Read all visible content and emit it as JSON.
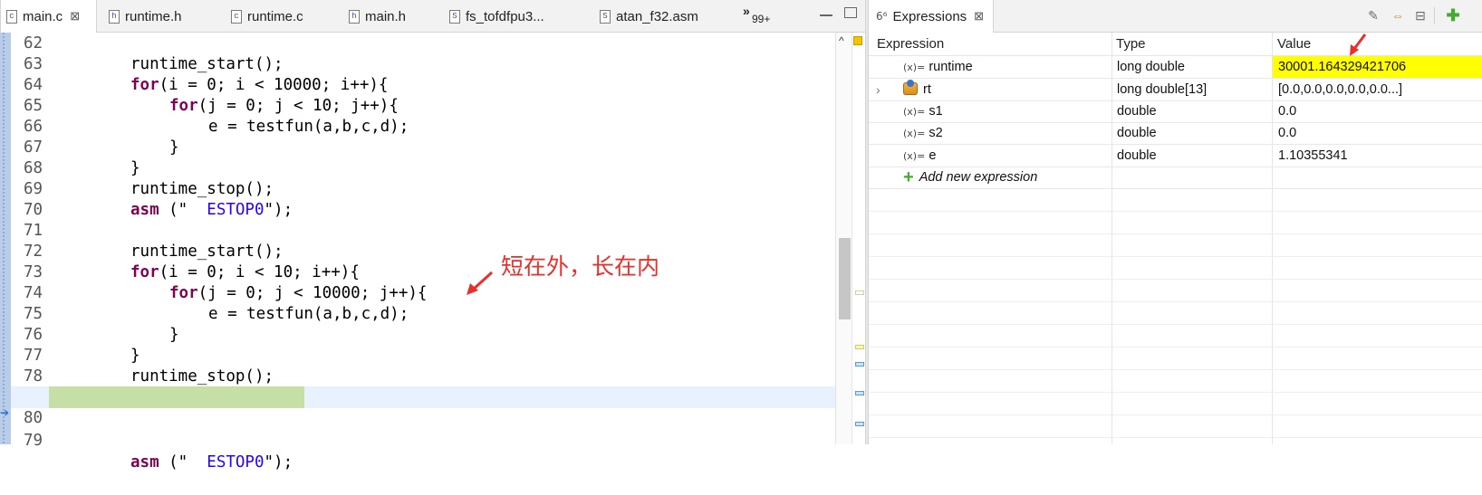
{
  "editor": {
    "tabs": [
      {
        "label": "main.c",
        "type": "c",
        "close": "⊠"
      },
      {
        "label": "runtime.h",
        "type": "h"
      },
      {
        "label": "runtime.c",
        "type": "c"
      },
      {
        "label": "main.h",
        "type": "h"
      },
      {
        "label": "fs_tofdfpu3...",
        "type": "S"
      },
      {
        "label": "atan_f32.asm",
        "type": "S"
      }
    ],
    "more_tabs_chevron": "»",
    "more_tabs_count": "99+",
    "lines": [
      {
        "num": "62",
        "code": ""
      },
      {
        "num": "63",
        "code": "runtime_start();"
      },
      {
        "num": "64",
        "kw": "for",
        "code": "(i = 0; i < 10000; i++){"
      },
      {
        "num": "65",
        "kw": "for",
        "code": "(j = 0; j < 10; j++){"
      },
      {
        "num": "66",
        "code": "e = testfun(a,b,c,d);"
      },
      {
        "num": "67",
        "code": "}"
      },
      {
        "num": "68",
        "code": "}"
      },
      {
        "num": "69",
        "code": "runtime_stop();"
      },
      {
        "num": "70",
        "kw": "asm",
        "code": " (\"  ESTOP0\");"
      },
      {
        "num": "71",
        "code": ""
      },
      {
        "num": "72",
        "code": "runtime_start();"
      },
      {
        "num": "73",
        "kw": "for",
        "code": "(i = 0; i < 10; i++){"
      },
      {
        "num": "74",
        "kw": "for",
        "code": "(j = 0; j < 10000; j++){"
      },
      {
        "num": "75",
        "code": "e = testfun(a,b,c,d);"
      },
      {
        "num": "76",
        "code": "}"
      },
      {
        "num": "77",
        "code": "}"
      },
      {
        "num": "78",
        "code": "runtime_stop();"
      },
      {
        "num": "79",
        "kw": "asm",
        "code": " (\"  ESTOP0\");"
      },
      {
        "num": "80",
        "code": ""
      }
    ],
    "annotation": "短在外，长在内"
  },
  "expressions": {
    "tab_label": "Expressions",
    "tab_close": "⊠",
    "columns": [
      "Expression",
      "Type",
      "Value"
    ],
    "rows": [
      {
        "icon": "(x)=",
        "name": "runtime",
        "type": "long double",
        "value": "30001.164329421706",
        "highlight": true
      },
      {
        "icon": "array",
        "name": "rt",
        "type": "long double[13]",
        "value": "[0.0,0.0,0.0,0.0,0.0...]",
        "expandable": true
      },
      {
        "icon": "(x)=",
        "name": "s1",
        "type": "double",
        "value": "0.0"
      },
      {
        "icon": "(x)=",
        "name": "s2",
        "type": "double",
        "value": "0.0"
      },
      {
        "icon": "(x)=",
        "name": "e",
        "type": "double",
        "value": "1.10355341"
      }
    ],
    "add_new_label": "Add new expression"
  },
  "colors": {
    "keyword": "#7f0055",
    "string": "#2a00ff",
    "current_line": "#e8f2fe",
    "debug_highlight": "#c6dfa6",
    "value_highlight": "#ffff00",
    "annotation": "#e8302a"
  }
}
